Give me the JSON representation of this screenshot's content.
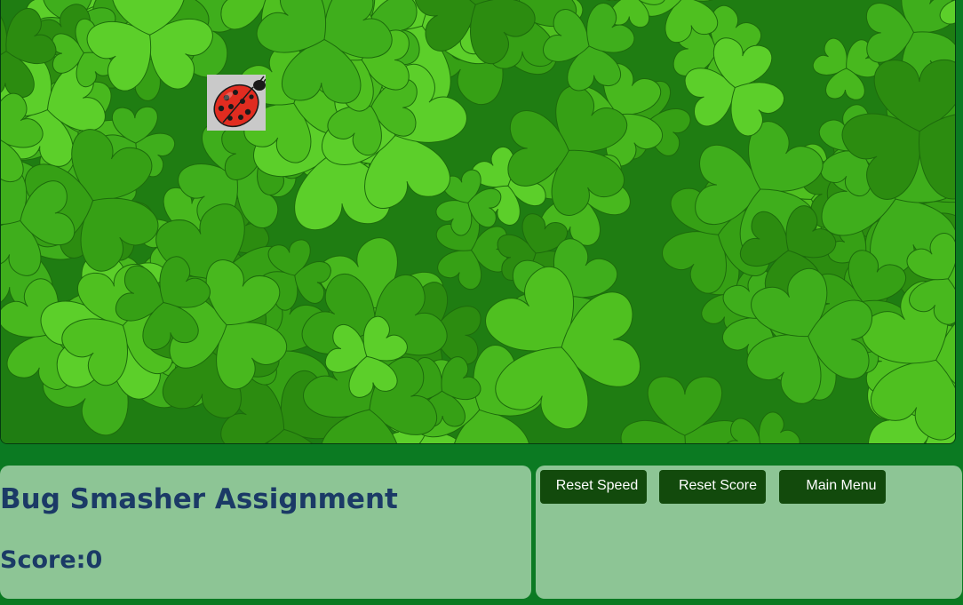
{
  "game": {
    "title": "Bug Smasher Assignment",
    "score_label": "Score:",
    "score_value": "0",
    "bug_icon": "ladybug-icon",
    "background": "clover-field"
  },
  "controls": {
    "reset_speed_label": "Reset Speed",
    "reset_score_label": "Reset Score",
    "main_menu_label": "Main Menu"
  },
  "colors": {
    "page_background": "#0b7a22",
    "panel_background": "#8dc595",
    "title_text": "#1b3a66",
    "button_background": "#124a0c",
    "button_text": "#ffffff"
  }
}
